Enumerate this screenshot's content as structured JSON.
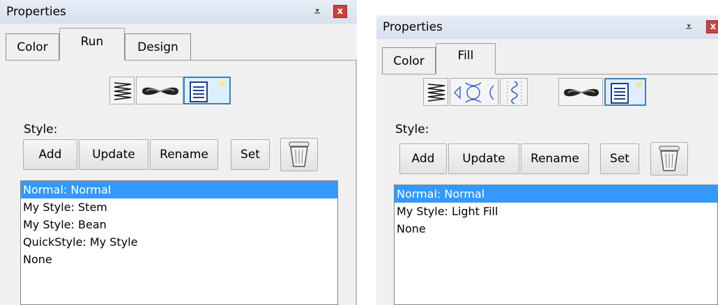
{
  "left_panel": {
    "title": "Properties",
    "pin_glyph": "⩡",
    "close_glyph": "x",
    "tabs": [
      {
        "label": "Color",
        "active": false
      },
      {
        "label": "Run",
        "active": true
      },
      {
        "label": "Design",
        "active": false
      }
    ],
    "style_tools": [
      "zigzag-run-icon",
      "bean-stitch-icon",
      "style-page-icon"
    ],
    "selected_tool": "style-page-icon",
    "style_label": "Style:",
    "buttons": {
      "add": "Add",
      "update": "Update",
      "rename": "Rename",
      "set": "Set",
      "delete_icon": "trash-can-icon"
    },
    "styles": [
      {
        "text": "Normal: Normal",
        "selected": true
      },
      {
        "text": "My Style: Stem",
        "selected": false
      },
      {
        "text": "My Style: Bean",
        "selected": false
      },
      {
        "text": "QuickStyle: My Style",
        "selected": false
      },
      {
        "text": "None",
        "selected": false
      }
    ]
  },
  "right_panel": {
    "title": "Properties",
    "pin_glyph": "⩡",
    "close_glyph": "x",
    "tabs": [
      {
        "label": "Color",
        "active": false
      },
      {
        "label": "Fill",
        "active": true
      }
    ],
    "style_tools": [
      "zigzag-fill-icon",
      "pattern-fill-icon",
      "wave-fill-icon",
      "bean-fill-icon",
      "style-page-icon"
    ],
    "selected_tool": "style-page-icon",
    "style_label": "Style:",
    "buttons": {
      "add": "Add",
      "update": "Update",
      "rename": "Rename",
      "set": "Set",
      "delete_icon": "trash-can-icon"
    },
    "styles": [
      {
        "text": "Normal: Normal",
        "selected": true
      },
      {
        "text": "My Style: Light Fill",
        "selected": false
      },
      {
        "text": "None",
        "selected": false
      }
    ]
  },
  "colors": {
    "selection": "#3399ff",
    "close_button": "#c9413f",
    "selected_tool_border": "#3c7fb1"
  }
}
